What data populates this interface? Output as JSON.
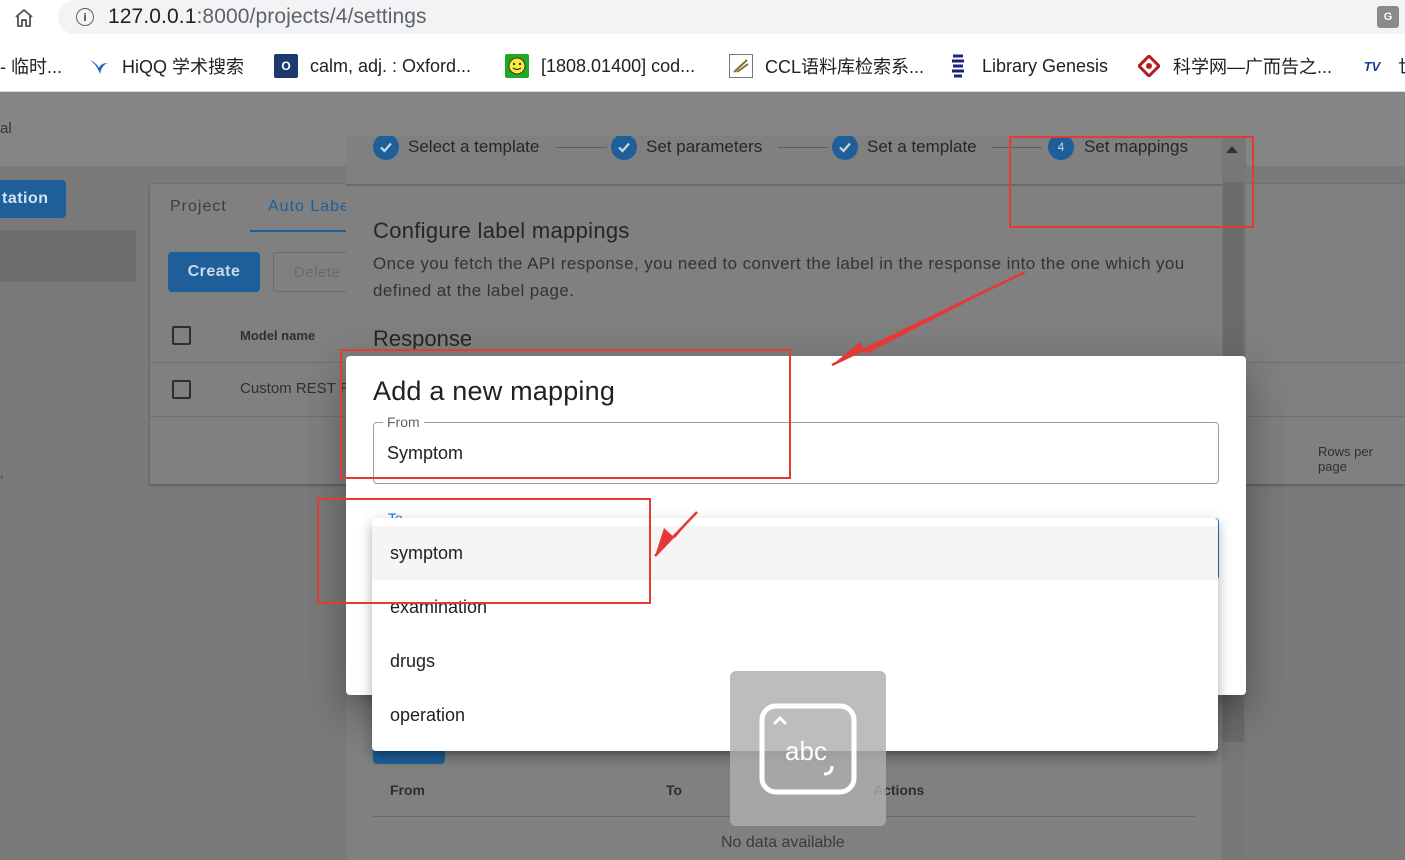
{
  "browser": {
    "url_host": "127.0.0.1",
    "url_rest": ":8000/projects/4/settings",
    "bookmarks": [
      {
        "label": "- 临时..."
      },
      {
        "label": "HiQQ 学术搜索"
      },
      {
        "label": "calm, adj. : Oxford..."
      },
      {
        "label": "[1808.01400] cod..."
      },
      {
        "label": "CCL语料库检索系..."
      },
      {
        "label": "Library Genesis"
      },
      {
        "label": "科学网—广而告之..."
      },
      {
        "label": "世"
      }
    ]
  },
  "app": {
    "header_fragment": "al",
    "side_button": "tation",
    "tabs": {
      "project": "Project",
      "auto_label": "Auto Labe"
    },
    "create_button": "Create",
    "delete_button": "Delete",
    "table": {
      "col_model": "Model name",
      "row_model": "Custom REST R"
    },
    "rows_per_page": "Rows per page"
  },
  "stepper": {
    "steps": [
      {
        "label": "Select a template",
        "done": true
      },
      {
        "label": "Set parameters",
        "done": true
      },
      {
        "label": "Set a template",
        "done": true
      },
      {
        "label": "Set mappings",
        "number": "4",
        "done": false
      }
    ],
    "section_title": "Configure label mappings",
    "section_desc": "Once you fetch the API response, you need to convert the label in the response into the one which you defined at the label page.",
    "response_title": "Response",
    "table_headers": {
      "from": "From",
      "to": "To",
      "actions": "Actions"
    },
    "no_data": "No data available"
  },
  "mapping_dialog": {
    "title": "Add a new mapping",
    "from_label": "From",
    "from_value": "Symptom",
    "to_label": "To",
    "options": [
      "symptom",
      "examination",
      "drugs",
      "operation"
    ],
    "highlighted_option": "symptom"
  },
  "keyboard_overlay": {
    "text": "abc"
  },
  "colors": {
    "primary": "#1976d2",
    "annotation": "#e53935"
  }
}
